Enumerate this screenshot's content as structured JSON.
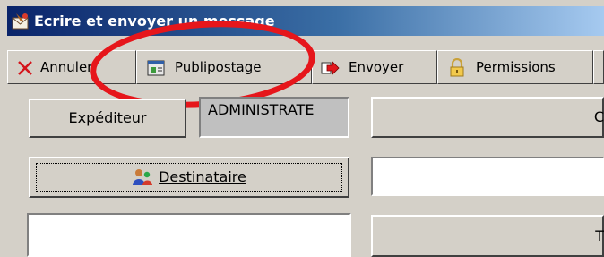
{
  "window": {
    "title": "Ecrire et envoyer un message",
    "icon": "mail-envelope-icon"
  },
  "toolbar": {
    "buttons": [
      {
        "name": "annuler",
        "label": "Annuler",
        "icon": "red-x-icon"
      },
      {
        "name": "publipostage",
        "label": "Publipostage",
        "icon": "mail-merge-icon"
      },
      {
        "name": "envoyer",
        "label": "Envoyer",
        "icon": "send-arrow-icon"
      },
      {
        "name": "permissions",
        "label": "Permissions",
        "icon": "padlock-icon"
      }
    ]
  },
  "form": {
    "sender_button_label": "Expéditeur",
    "sender_value": "ADMINISTRATE",
    "recipient_button_label": "Destinataire",
    "recipient_value": "",
    "right_button_1_label": "C",
    "right_button_2_label": "T"
  },
  "annotation": {
    "shape": "ellipse",
    "color": "#e6161b",
    "target": "Publipostage"
  }
}
